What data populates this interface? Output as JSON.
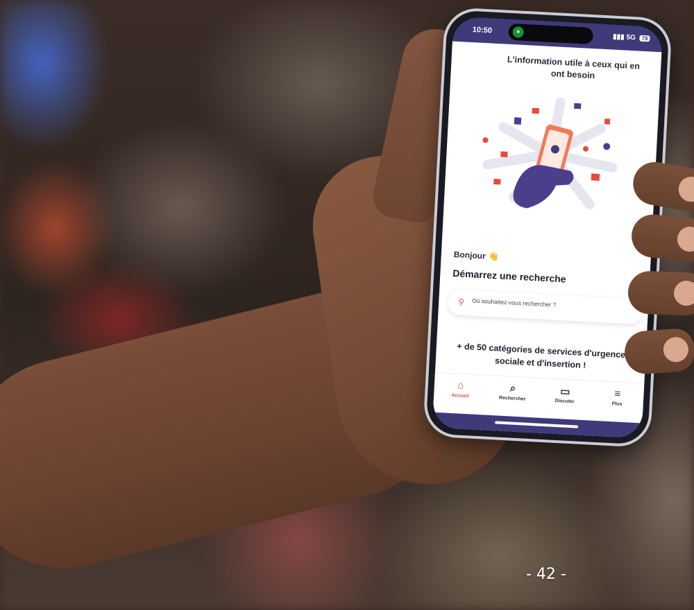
{
  "status_bar": {
    "time": "10:50",
    "signal": "5G",
    "battery": "78"
  },
  "header": {
    "tagline": "L'information utile à ceux qui en ont besoin"
  },
  "greeting": {
    "text": "Bonjour",
    "emoji": "👋"
  },
  "search": {
    "heading": "Démarrez une recherche",
    "placeholder": "Où souhaitez-vous rechercher ?"
  },
  "promo": {
    "text": "+ de 50 catégories de services d'urgence sociale et d'insertion !"
  },
  "tabs": [
    {
      "label": "Accueil",
      "icon": "home-icon",
      "active": true
    },
    {
      "label": "Rechercher",
      "icon": "search-icon",
      "active": false
    },
    {
      "label": "Discuter",
      "icon": "chat-icon",
      "active": false
    },
    {
      "label": "Plus",
      "icon": "menu-icon",
      "active": false
    }
  ],
  "page_number": "- 42 -",
  "colors": {
    "brand": "#3f3a7a",
    "accent": "#e84a3c"
  }
}
